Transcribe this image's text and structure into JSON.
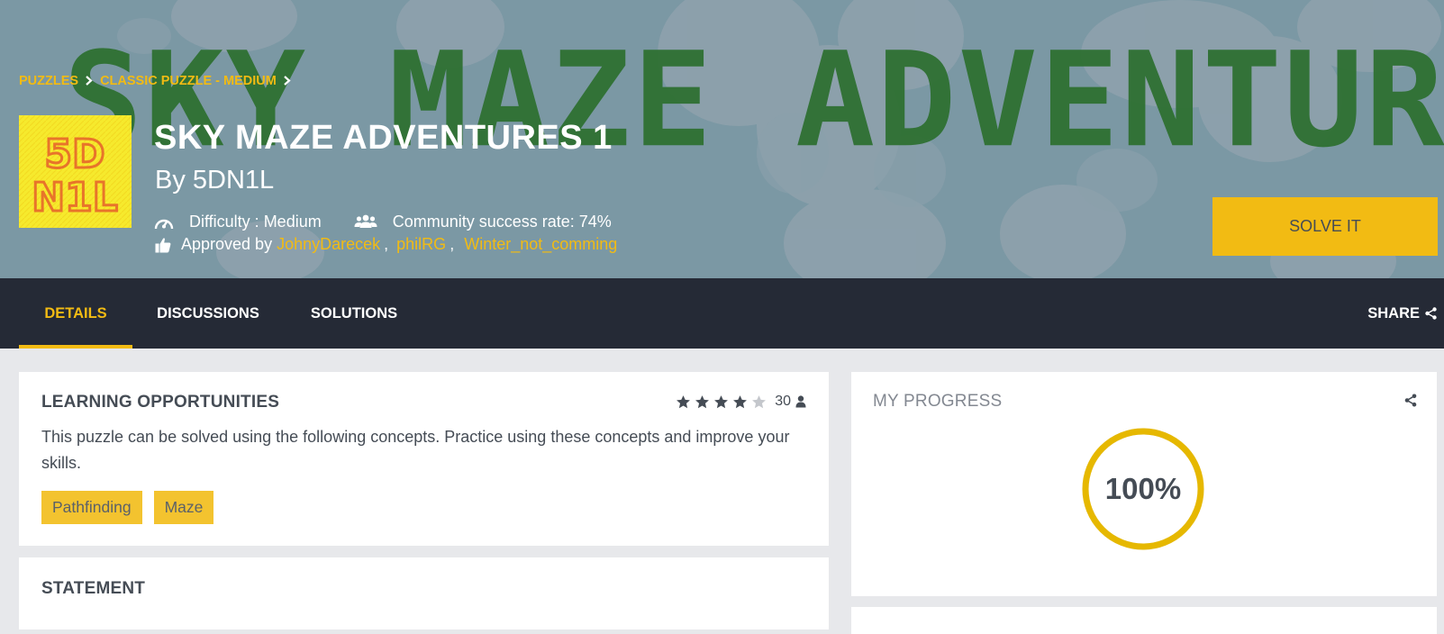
{
  "banner": {
    "text": "SKY MAZE ADVENTURES"
  },
  "breadcrumb": {
    "items": [
      "PUZZLES",
      "CLASSIC PUZZLE - MEDIUM"
    ],
    "separator": ">"
  },
  "avatar": {
    "line1": "5D",
    "line2": "N1L"
  },
  "puzzle": {
    "title": "SKY MAZE ADVENTURES 1",
    "author": "By 5DN1L",
    "difficulty": "Difficulty : Medium",
    "success_rate": "Community success rate: 74%",
    "approved_label": "Approved by",
    "approvers": [
      "JohnyDarecek",
      "philRG",
      "Winter_not_comming"
    ],
    "approver_separator": ","
  },
  "solve_button": "SOLVE IT",
  "nav": {
    "tabs": [
      "DETAILS",
      "DISCUSSIONS",
      "SOLUTIONS"
    ],
    "active_tab": "DETAILS",
    "share": "SHARE"
  },
  "learning": {
    "title": "LEARNING OPPORTUNITIES",
    "rating_stars": 4,
    "rating_max": 5,
    "rating_count": "30",
    "description": "This puzzle can be solved using the following concepts. Practice using these concepts and improve your skills.",
    "tags": [
      "Pathfinding",
      "Maze"
    ]
  },
  "statement": {
    "title": "STATEMENT"
  },
  "progress": {
    "title": "MY PROGRESS",
    "value_text": "100%",
    "value": 1.0
  },
  "colors": {
    "accent": "#f2bb13",
    "nav_bg": "#252a36",
    "banner_green": "#2f7032",
    "text_dark": "#454c55"
  },
  "icons": {
    "difficulty": "speedometer-icon",
    "community": "users-icon",
    "approved": "thumbs-up-icon",
    "share": "share-icon",
    "user": "user-icon",
    "star": "star-icon",
    "breadcrumb_sep": "chevron-right-icon"
  }
}
